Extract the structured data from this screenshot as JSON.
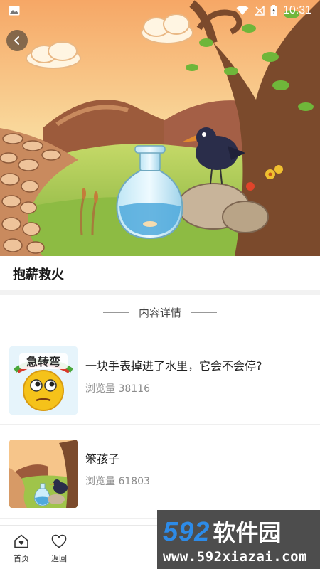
{
  "status_bar": {
    "time": "10:31"
  },
  "story": {
    "title": "抱薪救火"
  },
  "section": {
    "heading": "内容详情"
  },
  "items": [
    {
      "title": "一块手表掉进了水里，它会不会停?",
      "views": "浏览量 38116",
      "thumb_text": "急转弯"
    },
    {
      "title": "笨孩子",
      "views": "浏览量 61803"
    }
  ],
  "nav": [
    {
      "label": "首页",
      "icon": "home-icon"
    },
    {
      "label": "返回",
      "icon": "heart-icon"
    }
  ],
  "watermark": {
    "number": "592",
    "brand": "软件园",
    "url": "www.592xiazai.com"
  },
  "colors": {
    "sky": "#f7c98b",
    "grass": "#a7c84c",
    "path": "#e6b98a",
    "wm_blue": "#2d8be8"
  }
}
